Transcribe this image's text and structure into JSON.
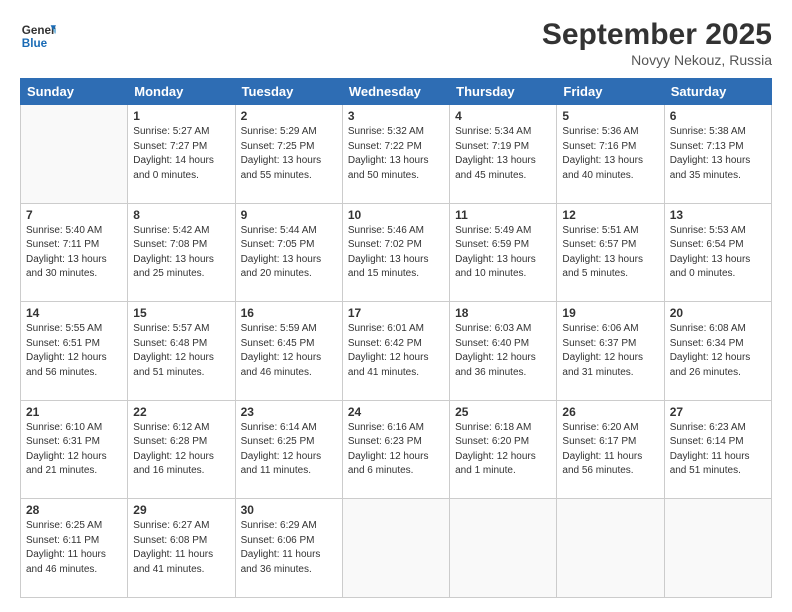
{
  "logo": {
    "general": "General",
    "blue": "Blue"
  },
  "title": "September 2025",
  "location": "Novyy Nekouz, Russia",
  "days_of_week": [
    "Sunday",
    "Monday",
    "Tuesday",
    "Wednesday",
    "Thursday",
    "Friday",
    "Saturday"
  ],
  "weeks": [
    [
      {
        "day": "",
        "info": ""
      },
      {
        "day": "1",
        "info": "Sunrise: 5:27 AM\nSunset: 7:27 PM\nDaylight: 14 hours\nand 0 minutes."
      },
      {
        "day": "2",
        "info": "Sunrise: 5:29 AM\nSunset: 7:25 PM\nDaylight: 13 hours\nand 55 minutes."
      },
      {
        "day": "3",
        "info": "Sunrise: 5:32 AM\nSunset: 7:22 PM\nDaylight: 13 hours\nand 50 minutes."
      },
      {
        "day": "4",
        "info": "Sunrise: 5:34 AM\nSunset: 7:19 PM\nDaylight: 13 hours\nand 45 minutes."
      },
      {
        "day": "5",
        "info": "Sunrise: 5:36 AM\nSunset: 7:16 PM\nDaylight: 13 hours\nand 40 minutes."
      },
      {
        "day": "6",
        "info": "Sunrise: 5:38 AM\nSunset: 7:13 PM\nDaylight: 13 hours\nand 35 minutes."
      }
    ],
    [
      {
        "day": "7",
        "info": "Sunrise: 5:40 AM\nSunset: 7:11 PM\nDaylight: 13 hours\nand 30 minutes."
      },
      {
        "day": "8",
        "info": "Sunrise: 5:42 AM\nSunset: 7:08 PM\nDaylight: 13 hours\nand 25 minutes."
      },
      {
        "day": "9",
        "info": "Sunrise: 5:44 AM\nSunset: 7:05 PM\nDaylight: 13 hours\nand 20 minutes."
      },
      {
        "day": "10",
        "info": "Sunrise: 5:46 AM\nSunset: 7:02 PM\nDaylight: 13 hours\nand 15 minutes."
      },
      {
        "day": "11",
        "info": "Sunrise: 5:49 AM\nSunset: 6:59 PM\nDaylight: 13 hours\nand 10 minutes."
      },
      {
        "day": "12",
        "info": "Sunrise: 5:51 AM\nSunset: 6:57 PM\nDaylight: 13 hours\nand 5 minutes."
      },
      {
        "day": "13",
        "info": "Sunrise: 5:53 AM\nSunset: 6:54 PM\nDaylight: 13 hours\nand 0 minutes."
      }
    ],
    [
      {
        "day": "14",
        "info": "Sunrise: 5:55 AM\nSunset: 6:51 PM\nDaylight: 12 hours\nand 56 minutes."
      },
      {
        "day": "15",
        "info": "Sunrise: 5:57 AM\nSunset: 6:48 PM\nDaylight: 12 hours\nand 51 minutes."
      },
      {
        "day": "16",
        "info": "Sunrise: 5:59 AM\nSunset: 6:45 PM\nDaylight: 12 hours\nand 46 minutes."
      },
      {
        "day": "17",
        "info": "Sunrise: 6:01 AM\nSunset: 6:42 PM\nDaylight: 12 hours\nand 41 minutes."
      },
      {
        "day": "18",
        "info": "Sunrise: 6:03 AM\nSunset: 6:40 PM\nDaylight: 12 hours\nand 36 minutes."
      },
      {
        "day": "19",
        "info": "Sunrise: 6:06 AM\nSunset: 6:37 PM\nDaylight: 12 hours\nand 31 minutes."
      },
      {
        "day": "20",
        "info": "Sunrise: 6:08 AM\nSunset: 6:34 PM\nDaylight: 12 hours\nand 26 minutes."
      }
    ],
    [
      {
        "day": "21",
        "info": "Sunrise: 6:10 AM\nSunset: 6:31 PM\nDaylight: 12 hours\nand 21 minutes."
      },
      {
        "day": "22",
        "info": "Sunrise: 6:12 AM\nSunset: 6:28 PM\nDaylight: 12 hours\nand 16 minutes."
      },
      {
        "day": "23",
        "info": "Sunrise: 6:14 AM\nSunset: 6:25 PM\nDaylight: 12 hours\nand 11 minutes."
      },
      {
        "day": "24",
        "info": "Sunrise: 6:16 AM\nSunset: 6:23 PM\nDaylight: 12 hours\nand 6 minutes."
      },
      {
        "day": "25",
        "info": "Sunrise: 6:18 AM\nSunset: 6:20 PM\nDaylight: 12 hours\nand 1 minute."
      },
      {
        "day": "26",
        "info": "Sunrise: 6:20 AM\nSunset: 6:17 PM\nDaylight: 11 hours\nand 56 minutes."
      },
      {
        "day": "27",
        "info": "Sunrise: 6:23 AM\nSunset: 6:14 PM\nDaylight: 11 hours\nand 51 minutes."
      }
    ],
    [
      {
        "day": "28",
        "info": "Sunrise: 6:25 AM\nSunset: 6:11 PM\nDaylight: 11 hours\nand 46 minutes."
      },
      {
        "day": "29",
        "info": "Sunrise: 6:27 AM\nSunset: 6:08 PM\nDaylight: 11 hours\nand 41 minutes."
      },
      {
        "day": "30",
        "info": "Sunrise: 6:29 AM\nSunset: 6:06 PM\nDaylight: 11 hours\nand 36 minutes."
      },
      {
        "day": "",
        "info": ""
      },
      {
        "day": "",
        "info": ""
      },
      {
        "day": "",
        "info": ""
      },
      {
        "day": "",
        "info": ""
      }
    ]
  ]
}
